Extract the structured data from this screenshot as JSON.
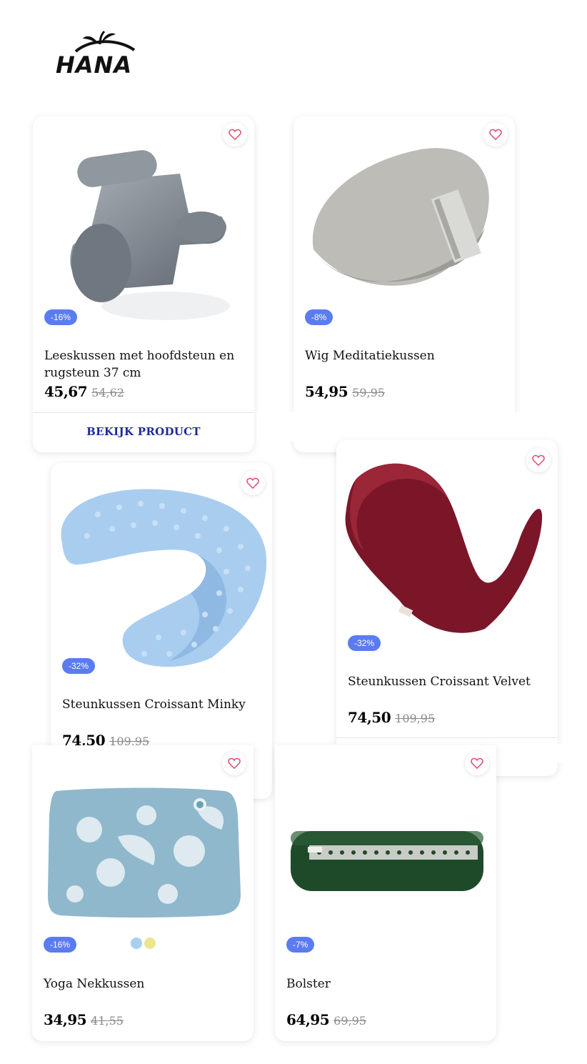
{
  "brand": {
    "logo_text": "HANA"
  },
  "products": [
    {
      "title": "Leeskussen met hoofdsteun en rugsteun 37 cm",
      "badge": "-16%",
      "price": "45,67",
      "old_price": "54,62",
      "cta": "BEKIJK PRODUCT"
    },
    {
      "title": "Wig Meditatiekussen",
      "badge": "-8%",
      "price": "54,95",
      "old_price": "59,95"
    },
    {
      "title": "Steunkussen Croissant Minky",
      "badge": "-32%",
      "price": "74,50",
      "old_price": "109,95"
    },
    {
      "title": "Steunkussen Croissant Velvet",
      "badge": "-32%",
      "price": "74,50",
      "old_price": "109,95"
    },
    {
      "title": "Yoga Nekkussen",
      "badge": "-16%",
      "price": "34,95",
      "old_price": "41,55",
      "swatches": [
        "#a9d0ee",
        "#e8e78c"
      ]
    },
    {
      "title": "Bolster",
      "badge": "-7%",
      "price": "64,95",
      "old_price": "69,95"
    }
  ],
  "colors": {
    "badge": "#5b7cf0",
    "heart": "#e24a6a",
    "cta": "#1f2a9a"
  },
  "icons": {
    "favorite": "heart-outline-icon"
  }
}
